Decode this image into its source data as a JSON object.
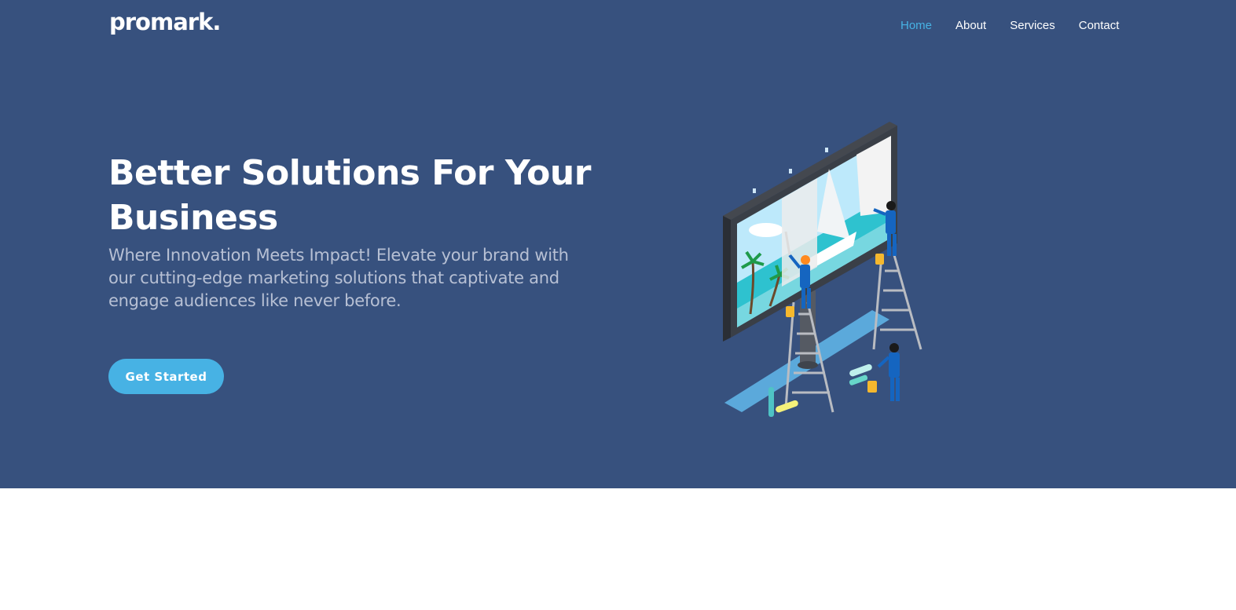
{
  "brand": {
    "logo_text": "promark."
  },
  "nav": {
    "items": [
      {
        "label": "Home",
        "active": true
      },
      {
        "label": "About",
        "active": false
      },
      {
        "label": "Services",
        "active": false
      },
      {
        "label": "Contact",
        "active": false
      }
    ]
  },
  "hero": {
    "title": "Better Solutions For Your Business",
    "subtitle": "Where Innovation Meets Impact! Elevate your brand with our cutting-edge marketing solutions that captivate and engage audiences like never before.",
    "cta_label": "Get Started",
    "illustration": "billboard-painters-illustration"
  },
  "colors": {
    "hero_background": "#37517e",
    "accent": "#47b2e4",
    "subtitle_text": "#b7c0d4",
    "page_background": "#ffffff"
  }
}
